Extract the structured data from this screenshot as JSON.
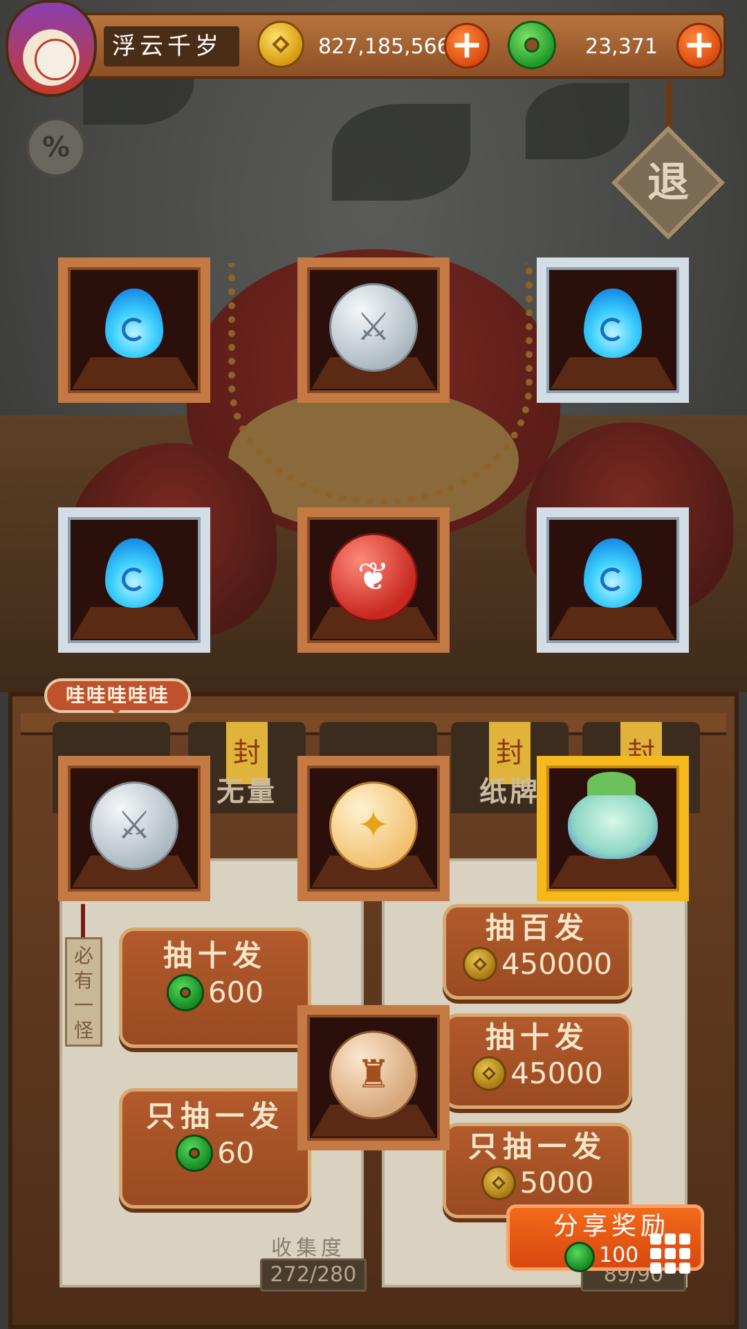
{
  "player": {
    "name": "浮云千岁"
  },
  "currency": {
    "coins": "827,185,566",
    "jade": "23,371"
  },
  "icons": {
    "help": "%",
    "exit": "退",
    "plus": "+"
  },
  "speech_bubble": "哇哇哇哇哇",
  "categories": [
    {
      "label": ""
    },
    {
      "label": "无量",
      "seal": "封"
    },
    {
      "label": ""
    },
    {
      "label": "纸牌",
      "seal": "封"
    },
    {
      "label": "",
      "seal": "封"
    }
  ],
  "hang_tag": "必有一怪",
  "draw_left": {
    "ten": {
      "title": "抽十发",
      "cost": "600"
    },
    "one": {
      "title": "只抽一发",
      "cost": "60"
    }
  },
  "draw_right": {
    "hundred": {
      "title": "抽百发",
      "cost": "450000"
    },
    "ten": {
      "title": "抽十发",
      "cost": "45000"
    },
    "one": {
      "title": "只抽一发",
      "cost": "5000"
    }
  },
  "collection": {
    "label": "收集度",
    "progress": "272/280",
    "progress_right": "89/90"
  },
  "share": {
    "title": "分享奖励",
    "reward": "100"
  },
  "reward_slots": [
    {
      "item": "blue-flame",
      "frame": "wood"
    },
    {
      "item": "sword-orb",
      "frame": "wood"
    },
    {
      "item": "blue-flame",
      "frame": "silver"
    },
    {
      "item": "blue-flame",
      "frame": "silver"
    },
    {
      "item": "red-emblem-orb",
      "frame": "wood"
    },
    {
      "item": "blue-flame",
      "frame": "silver"
    },
    {
      "item": "sword-orb",
      "frame": "wood"
    },
    {
      "item": "gold-emblem-orb",
      "frame": "wood"
    },
    {
      "item": "leaf-sprite",
      "frame": "gold"
    },
    {
      "item": "lantern-orb",
      "frame": "wood"
    }
  ]
}
